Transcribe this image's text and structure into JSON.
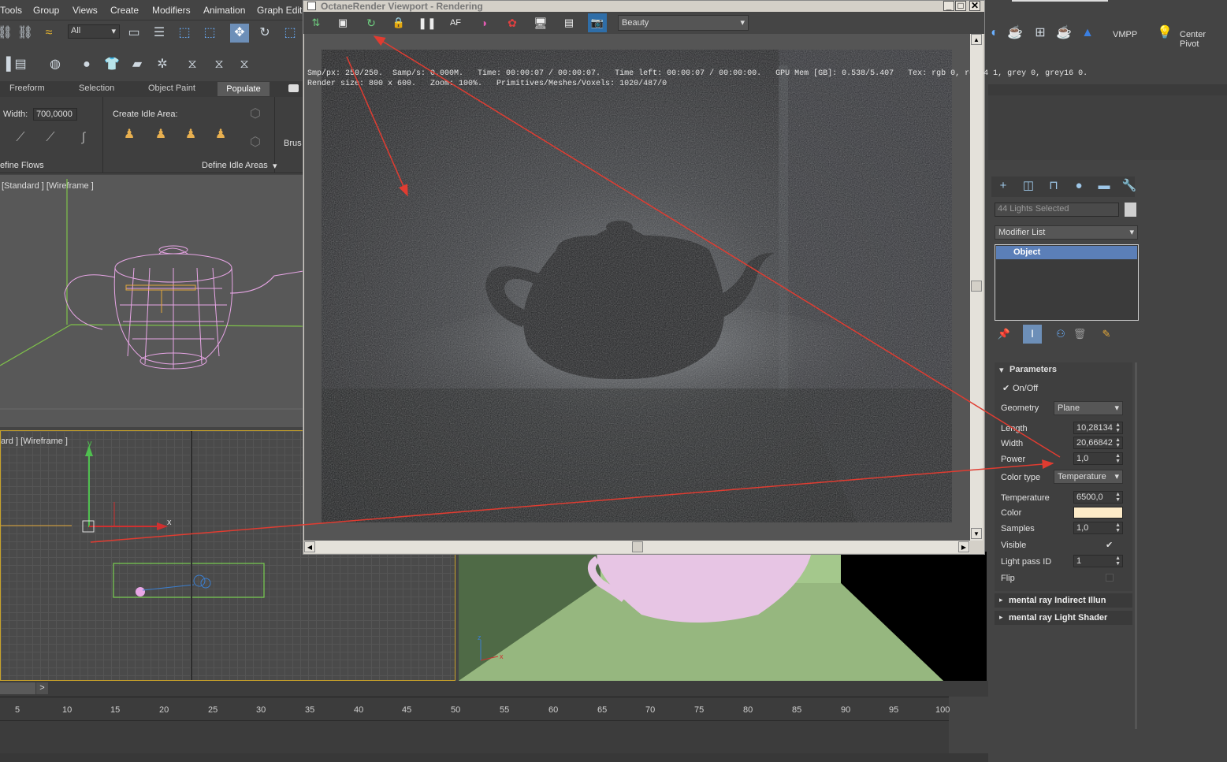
{
  "menubar": {
    "items": [
      "Tools",
      "Group",
      "Views",
      "Create",
      "Modifiers",
      "Animation",
      "Graph Edito"
    ]
  },
  "main_toolbar": {
    "selection_filter": "All"
  },
  "ribbon": {
    "tabs": [
      "Freeform",
      "Selection",
      "Object Paint",
      "Populate"
    ],
    "width_label": "Width:",
    "width_value": "700,0000",
    "idle_area_label": "Create Idle Area:",
    "brush_label": "Brus",
    "define_flows": "efine Flows",
    "define_idle_areas": "Define Idle Areas"
  },
  "viewports": {
    "top_left_label": "[Standard ] [Wireframe ]",
    "bottom_left_label": "ard ] [Wireframe ]",
    "axis_x": "x",
    "axis_y": "y",
    "axis_z": "z"
  },
  "octane": {
    "title": "OctaneRender Viewport - Rendering",
    "pass_select": "Beauty",
    "info_line1": "Smp/px: 250/250.  Samp/s: 0.000M.   Time: 00:00:07 / 00:00:07.   Time left: 00:00:07 / 00:00:00.   GPU Mem [GB]: 0.538/5.407   Tex: rgb 0, rgb64 1, grey 0, grey16 0.",
    "info_line2": "Render size: 800 x 600.   Zoom: 100%.   Primitives/Meshes/Voxels: 1020/487/0"
  },
  "right_toolbar": {
    "vmpp": "VMPP",
    "center_pivot": "Center Pivot"
  },
  "command_panel": {
    "selection_name": "44 Lights Selected",
    "modifier_list": "Modifier List",
    "stack_item": "Object",
    "params_title": "Parameters",
    "on_off": "On/Off",
    "geometry_label": "Geometry",
    "geometry_value": "Plane",
    "length_label": "Length",
    "length_value": "10,28134",
    "width_label": "Width",
    "width_value": "20,66842",
    "power_label": "Power",
    "power_value": "1,0",
    "color_type_label": "Color type",
    "color_type_value": "Temperature",
    "temperature_label": "Temperature",
    "temperature_value": "6500,0",
    "color_label": "Color",
    "color_swatch": "#fdebc8",
    "samples_label": "Samples",
    "samples_value": "1,0",
    "visible_label": "Visible",
    "light_pass_label": "Light pass ID",
    "light_pass_value": "1",
    "flip_label": "Flip",
    "rollout_1": "mental ray Indirect Illun",
    "rollout_2": "mental ray Light Shader"
  },
  "timeline": {
    "frame_ticks": [
      "5",
      "10",
      "15",
      "20",
      "25",
      "30",
      "35",
      "40",
      "45",
      "50",
      "55",
      "60",
      "65",
      "70",
      "75",
      "80",
      "85",
      "90",
      "95",
      "100"
    ],
    "next_button": ">"
  },
  "colors": {
    "annotation_arrow": "#e03c31",
    "wire_teapot": "#e8a6e6",
    "accent_blue": "#4a6fa5"
  }
}
